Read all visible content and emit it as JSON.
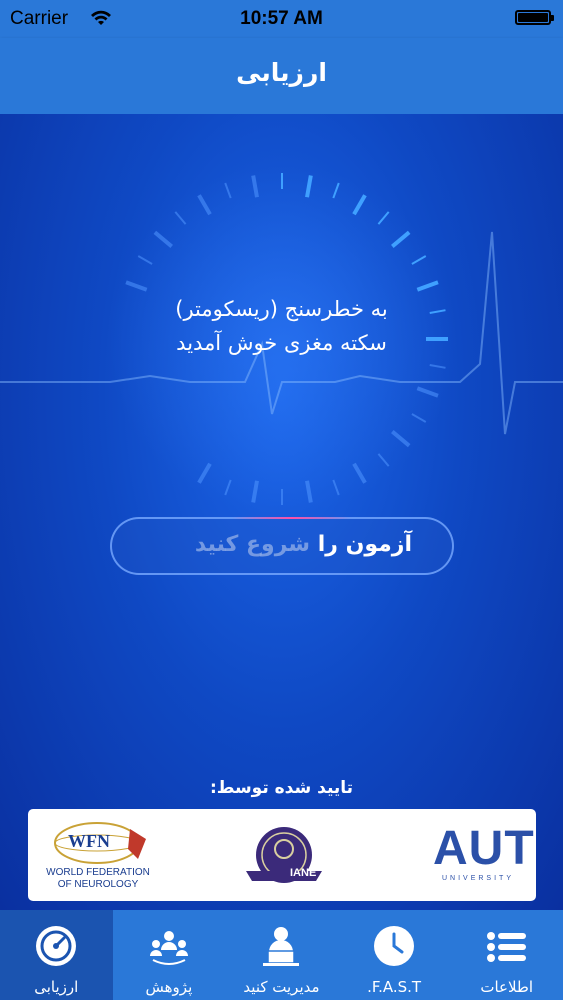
{
  "status": {
    "carrier": "Carrier",
    "time": "10:57 AM"
  },
  "nav": {
    "title": "ارزیابی"
  },
  "hero": {
    "welcome_line1": "به خطرسنج (ریسکومتر)",
    "welcome_line2": "سکته مغزی خوش آمدید"
  },
  "start": {
    "word1": "آزمون",
    "word2": "را",
    "word3": "شروع کنید"
  },
  "endorsed": {
    "label": "تایید شده توسط:",
    "wfn_mark": "WFN",
    "wfn_line1": "WORLD FEDERATION",
    "wfn_line2": "OF NEUROLOGY",
    "iane": "IANE",
    "aut": "AUT",
    "aut_sub": "UNIVERSITY"
  },
  "tabs": [
    {
      "label": "ارزیابی",
      "icon": "gauge-icon",
      "active": true
    },
    {
      "label": "پژوهش",
      "icon": "people-icon",
      "active": false
    },
    {
      "label": "مدیریت کنید",
      "icon": "user-laptop-icon",
      "active": false
    },
    {
      "label": "F.A.S.T.",
      "icon": "clock-icon",
      "active": false
    },
    {
      "label": "اطلاعات",
      "icon": "list-icon",
      "active": false
    }
  ],
  "colors": {
    "bar": "#2a78d8",
    "active_tab": "#1b54b0",
    "background": "#0f49c4"
  }
}
